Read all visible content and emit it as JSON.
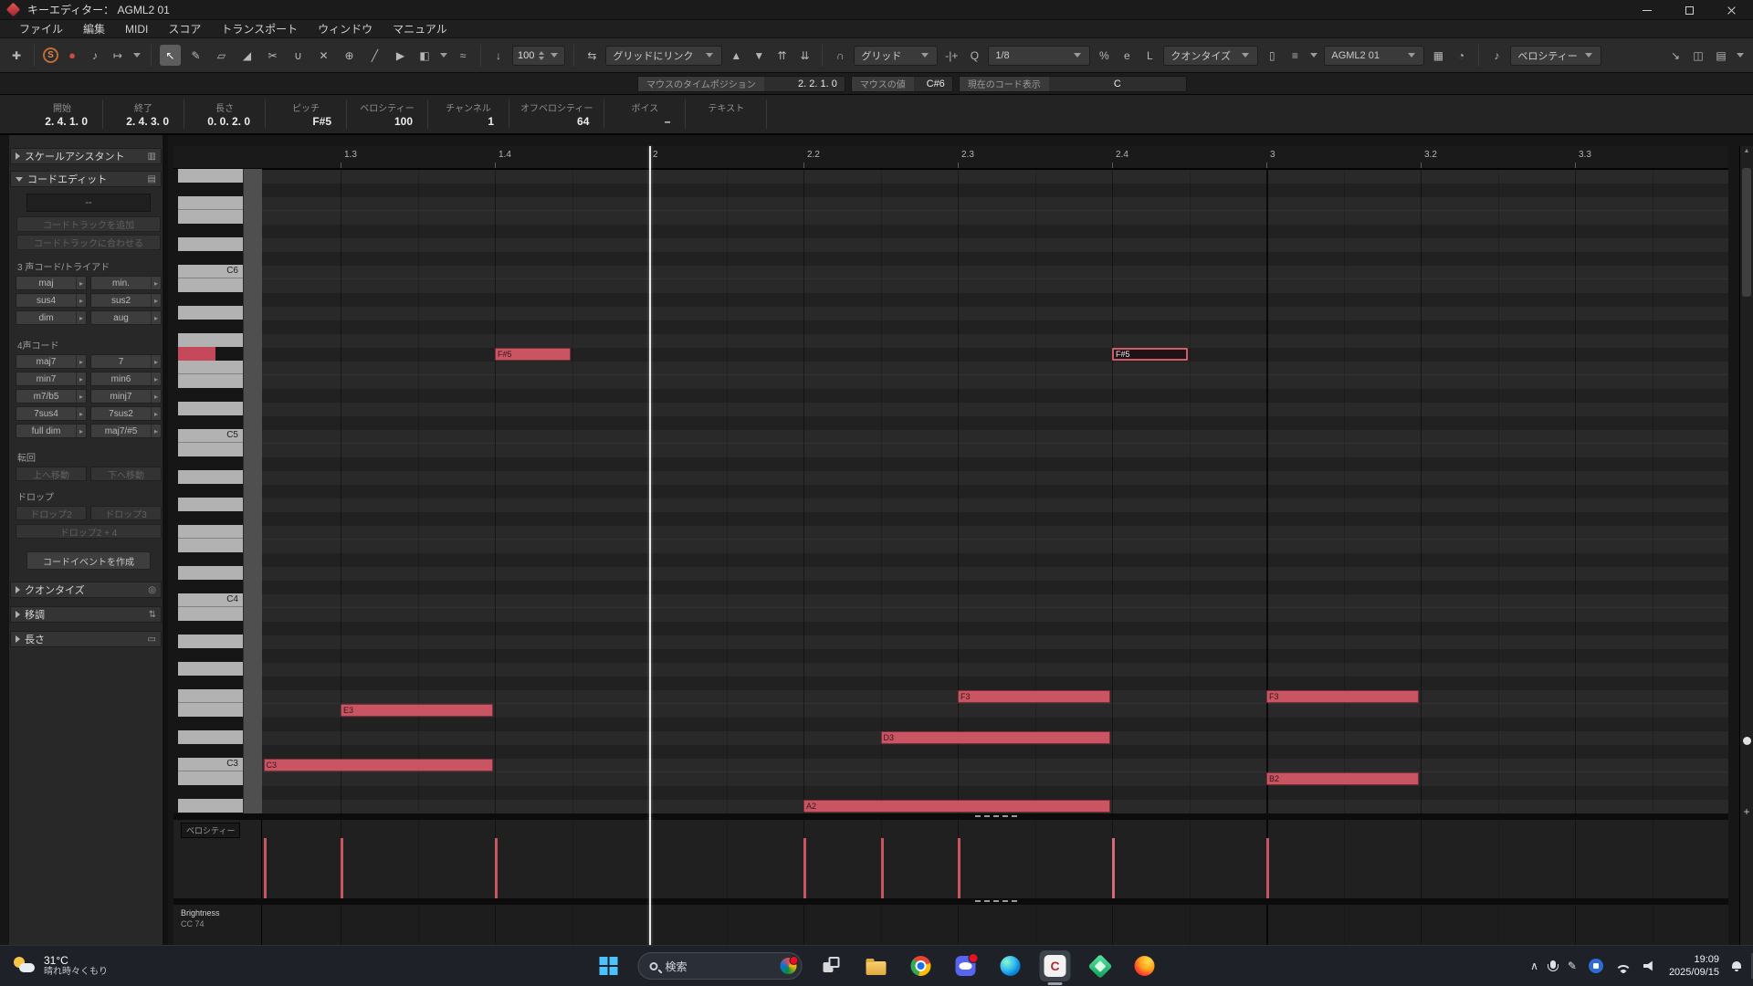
{
  "window": {
    "title": "キーエディター： AGML2 01"
  },
  "menubar": [
    "ファイル",
    "編集",
    "MIDI",
    "スコア",
    "トランスポート",
    "ウィンドウ",
    "マニュアル"
  ],
  "toolbar": {
    "insert_velocity": "100",
    "grid_link": "グリッドにリンク",
    "grid_mode": "グリッド",
    "quantize_value": "1/8",
    "length_quantize": "クオンタイズ",
    "part_name": "AGML2 01",
    "event_display": "ベロシティー"
  },
  "status_row": {
    "mouse_time_label": "マウスのタイムポジション",
    "mouse_time_value": "2. 2. 1. 0",
    "mouse_value_label": "マウスの値",
    "mouse_value": "C#6",
    "chord_label": "現在のコード表示",
    "chord_value": "C"
  },
  "note_info": [
    {
      "label": "開始",
      "value": "2. 4. 1. 0"
    },
    {
      "label": "終了",
      "value": "2. 4. 3. 0"
    },
    {
      "label": "長さ",
      "value": "0. 0. 2. 0"
    },
    {
      "label": "ピッチ",
      "value": "F#5"
    },
    {
      "label": "ベロシティー",
      "value": "100"
    },
    {
      "label": "チャンネル",
      "value": "1"
    },
    {
      "label": "オフベロシティー",
      "value": "64"
    },
    {
      "label": "ボイス",
      "value": "–"
    },
    {
      "label": "テキスト",
      "value": ""
    }
  ],
  "sidebar": {
    "scale_assistant": "スケールアシスタント",
    "chord_edit": "コードエディット",
    "chord_display": "--",
    "add_chord_track": "コードトラックを追加",
    "match_chord_track": "コードトラックに合わせる",
    "triads_label": "3 声コード/トライアド",
    "triads": [
      "maj",
      "min.",
      "sus4",
      "sus2",
      "dim",
      "aug"
    ],
    "tetrads_label": "4声コード",
    "tetrads": [
      "maj7",
      "7",
      "min7",
      "min6",
      "m7/b5",
      "minj7",
      "7sus4",
      "7sus2",
      "full dim",
      "maj7/#5"
    ],
    "inversion_label": "転回",
    "inversion_buttons": [
      "上へ移動",
      "下へ移動"
    ],
    "drop_label": "ドロップ",
    "drop_buttons": [
      "ドロップ2",
      "ドロップ3"
    ],
    "drop_wide_button": "ドロップ2 + 4",
    "create_chord_event": "コードイベントを作成",
    "quantize_header": "クオンタイズ",
    "transpose_header": "移調",
    "length_header": "長さ"
  },
  "ruler_ticks": [
    {
      "label": "1.3",
      "beat": 2
    },
    {
      "label": "1.4",
      "beat": 3
    },
    {
      "label": "2",
      "beat": 4
    },
    {
      "label": "2.2",
      "beat": 5
    },
    {
      "label": "2.3",
      "beat": 6
    },
    {
      "label": "2.4",
      "beat": 7
    },
    {
      "label": "3",
      "beat": 8
    },
    {
      "label": "3.2",
      "beat": 9
    },
    {
      "label": "3.3",
      "beat": 10
    }
  ],
  "playhead_beat": 4,
  "keyboard": {
    "highlighted_key": "F#5",
    "c_labels": [
      "C6",
      "C5",
      "C4",
      "C3"
    ]
  },
  "notes": [
    {
      "pitch": "C3",
      "start": 1.5,
      "end": 3,
      "velocity": 100,
      "selected": false
    },
    {
      "pitch": "E3",
      "start": 2,
      "end": 3,
      "velocity": 100,
      "selected": false
    },
    {
      "pitch": "F#5",
      "start": 3,
      "end": 3.5,
      "velocity": 100,
      "selected": false
    },
    {
      "pitch": "A2",
      "start": 5,
      "end": 7,
      "velocity": 100,
      "selected": false
    },
    {
      "pitch": "D3",
      "start": 5.5,
      "end": 7,
      "velocity": 100,
      "selected": false
    },
    {
      "pitch": "F3",
      "start": 6,
      "end": 7,
      "velocity": 100,
      "selected": false
    },
    {
      "pitch": "F#5",
      "start": 7,
      "end": 7.5,
      "velocity": 100,
      "selected": true
    },
    {
      "pitch": "F3",
      "start": 8,
      "end": 9,
      "velocity": 100,
      "selected": false
    },
    {
      "pitch": "B2",
      "start": 8,
      "end": 9,
      "velocity": 100,
      "selected": false
    }
  ],
  "velocity_lane_label": "ベロシティー",
  "cc_lane": {
    "name": "Brightness",
    "number": "CC 74"
  },
  "taskbar": {
    "weather_temp": "31°C",
    "weather_desc": "晴れ時々くもり",
    "search_placeholder": "検索",
    "time": "19:09",
    "date": "2025/09/15"
  },
  "icons": {
    "setup": "✚",
    "solo": "S",
    "record": "●",
    "feedback": "♪",
    "autoscroll": "↦",
    "tool_select": "↖",
    "tool_draw": "✎",
    "tool_erase": "▱",
    "tool_trim": "◢",
    "tool_split": "✂",
    "tool_glue": "∪",
    "tool_mute": "✕",
    "tool_zoom": "⊕",
    "tool_line": "╱",
    "tool_play": "▶",
    "color": "◧",
    "curve": "≈",
    "insert_velocity": "↓",
    "link_grid": "⇆",
    "step_up": "▲",
    "step_down": "▼",
    "step_up2": "⇈",
    "step_down2": "⇊",
    "snap": "∩",
    "nudge": "-|+",
    "q": "Q",
    "swing": "%",
    "iq": "e",
    "l": "L",
    "part": "▯",
    "layers": "≡",
    "griddots": "▦",
    "loop": "◔",
    "noteexp": "♪",
    "diag": "↘",
    "win1": "◫",
    "win2": "▤",
    "mini_arrow": "▸",
    "piano": "▥",
    "list": "▤",
    "qcircle": "◎",
    "updown": "⇅",
    "ruler": "▭",
    "chevron_up": "∧",
    "pen": "✎",
    "scroll_up": "▲",
    "zoom_plus": "+"
  }
}
